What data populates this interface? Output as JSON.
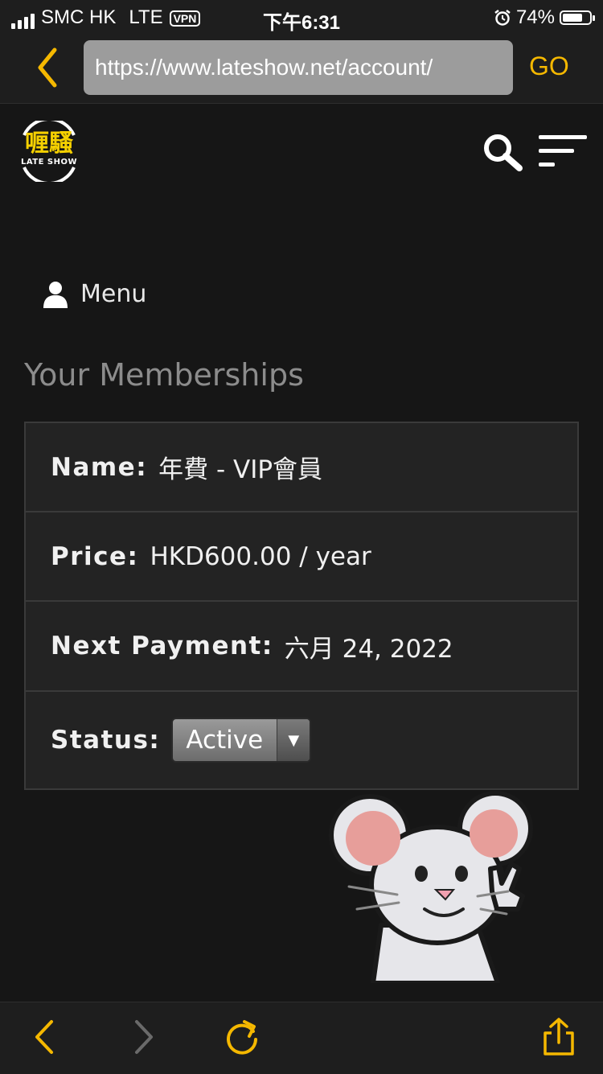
{
  "status_bar": {
    "carrier": "SMC HK",
    "network": "LTE",
    "vpn": "VPN",
    "time": "下午6:31",
    "battery": "74%",
    "battery_level": 0.74
  },
  "browser": {
    "url": "https://www.lateshow.net/account/",
    "go_label": "GO"
  },
  "site": {
    "logo_text": "喱騷",
    "logo_subtext": "LATE SHOW"
  },
  "account_menu": {
    "label": "Menu"
  },
  "memberships": {
    "heading": "Your Memberships",
    "name_label": "Name:",
    "name_value": "年費 - VIP會員",
    "price_label": "Price:",
    "price_value": "HKD600.00 / year",
    "next_payment_label": "Next Payment:",
    "next_payment_value": "六月 24, 2022",
    "status_label": "Status:",
    "status_value": "Active"
  },
  "colors": {
    "accent": "#f5b800",
    "background": "#161616",
    "table_bg": "#232323"
  }
}
